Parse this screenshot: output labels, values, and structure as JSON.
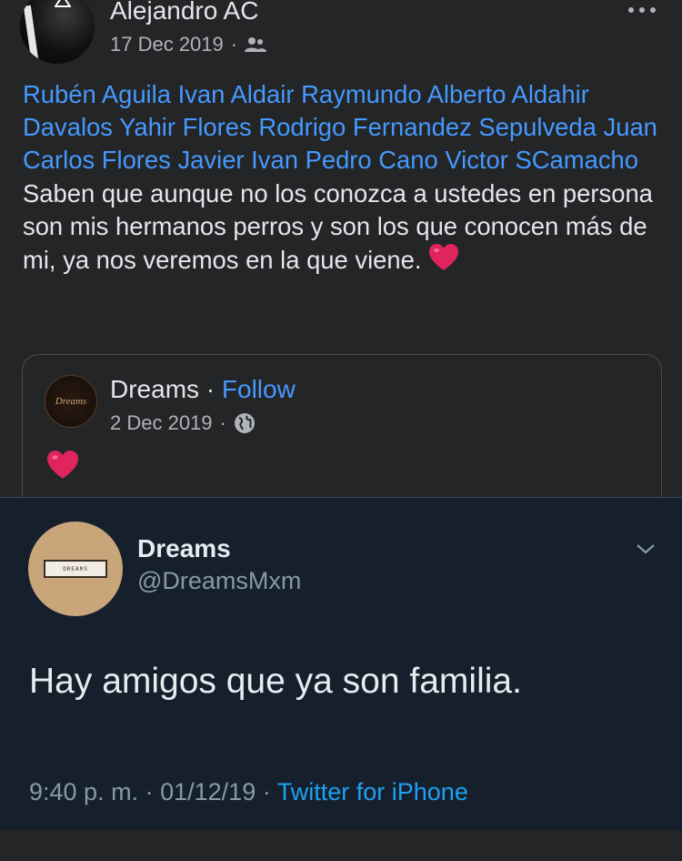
{
  "post": {
    "author": "Alejandro AC",
    "date": "17 Dec 2019",
    "meta_separator": "·",
    "audience_icon": "friends-icon",
    "more_icon": "more-dots-icon",
    "mentions": [
      "Rubén Aguila",
      "Ivan Aldair",
      "Raymundo Alberto Aldahir Davalos",
      "Yahir Flores",
      "Rodrigo Fernandez Sepulveda",
      "Juan Carlos Flores",
      "Javier Ivan",
      "Pedro Cano",
      "Victor SCamacho"
    ],
    "text": "Saben que aunque no los conozca a ustedes en persona son mis hermanos perros y son los que conocen más de mi, ya nos veremos en la que viene.",
    "emoji": "heart-icon"
  },
  "shared": {
    "page_name": "Dreams",
    "separator": "·",
    "follow_label": "Follow",
    "date": "2 Dec 2019",
    "audience_icon": "globe-icon",
    "emoji": "heart-icon"
  },
  "tweet": {
    "display_name": "Dreams",
    "handle": "@DreamsMxm",
    "avatar_text": "DREAMS",
    "text": "Hay amigos que ya son familia.",
    "time": "9:40 p. m.",
    "separator": "·",
    "date": "01/12/19",
    "source": "Twitter for iPhone"
  },
  "colors": {
    "fb_background": "#242526",
    "link_blue": "#4599ff",
    "twitter_background": "#16202c",
    "twitter_blue": "#1da1f2",
    "heart_red": "#e0245e"
  }
}
